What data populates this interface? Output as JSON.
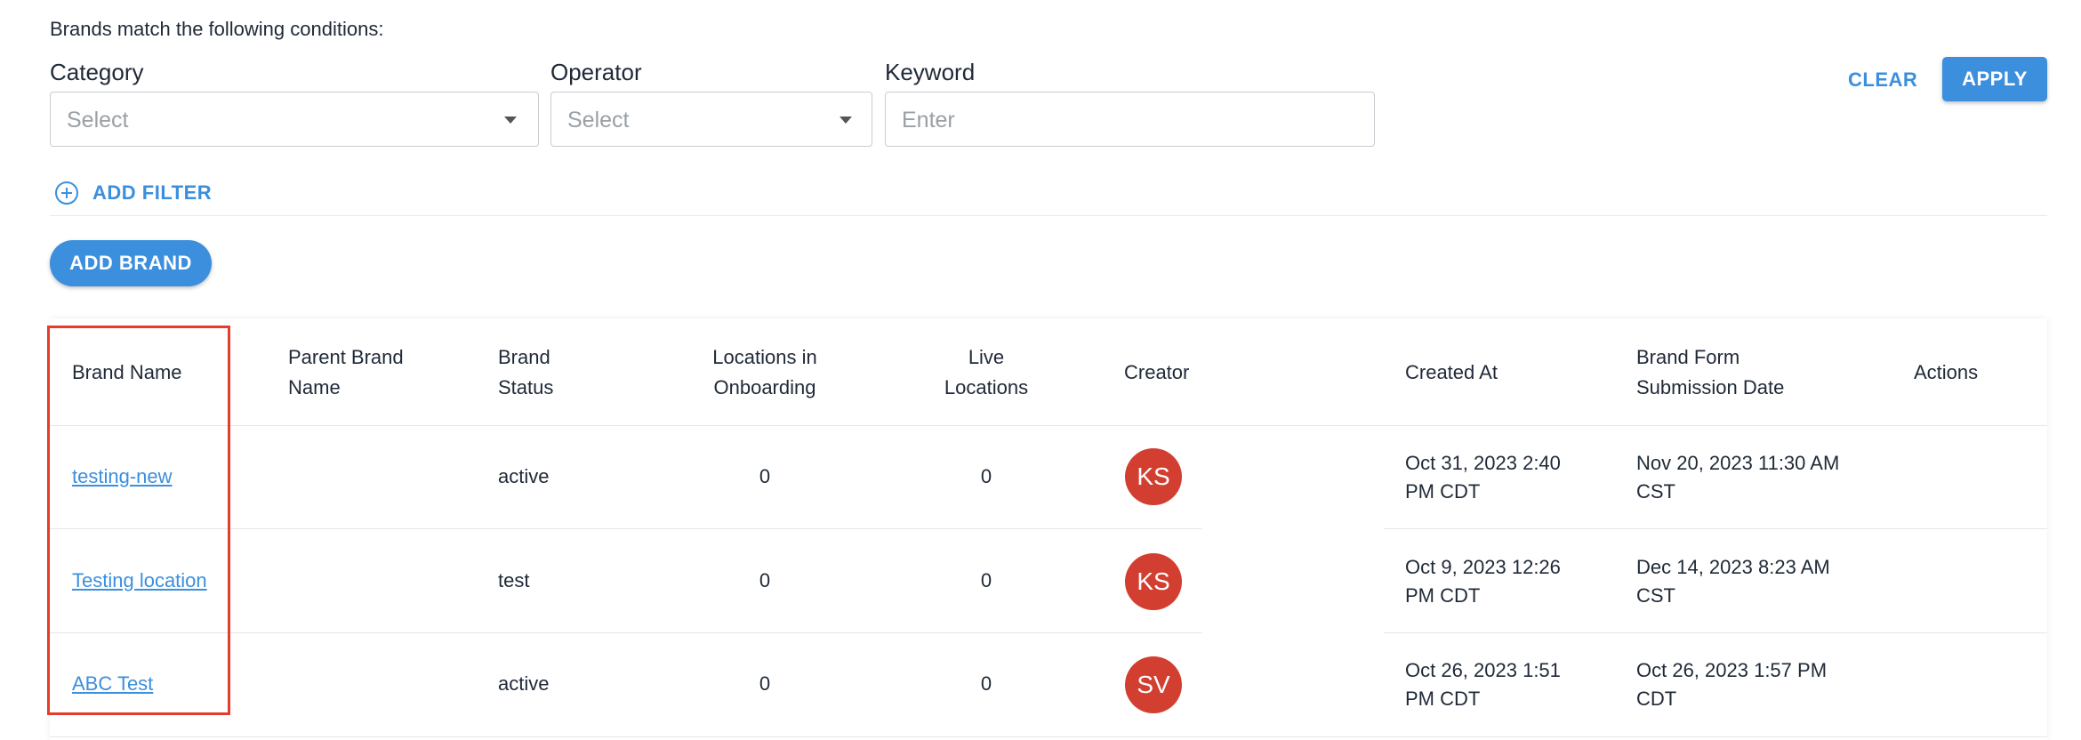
{
  "filters": {
    "conditions_text": "Brands match the following conditions:",
    "category": {
      "label": "Category",
      "placeholder": "Select"
    },
    "operator": {
      "label": "Operator",
      "placeholder": "Select"
    },
    "keyword": {
      "label": "Keyword",
      "placeholder": "Enter"
    },
    "clear_label": "CLEAR",
    "apply_label": "APPLY",
    "add_filter_label": "ADD FILTER"
  },
  "add_brand_label": "ADD BRAND",
  "table": {
    "headers": {
      "brand_name": "Brand Name",
      "parent_brand_name_1": "Parent Brand",
      "parent_brand_name_2": "Name",
      "brand_status_1": "Brand",
      "brand_status_2": "Status",
      "locations_onboarding_1": "Locations in",
      "locations_onboarding_2": "Onboarding",
      "live_locations_1": "Live",
      "live_locations_2": "Locations",
      "creator": "Creator",
      "created_at": "Created At",
      "submission_date_1": "Brand Form",
      "submission_date_2": "Submission Date",
      "actions": "Actions"
    },
    "rows": [
      {
        "brand_name": "testing-new",
        "parent_brand_name": "",
        "status": "active",
        "locations_onboarding": "0",
        "live_locations": "0",
        "creator_initials": "KS",
        "created_at_1": "Oct 31, 2023 2:40",
        "created_at_2": "PM CDT",
        "submission_1": "Nov 20, 2023 11:30 AM",
        "submission_2": "CST"
      },
      {
        "brand_name": "Testing location",
        "parent_brand_name": "",
        "status": "test",
        "locations_onboarding": "0",
        "live_locations": "0",
        "creator_initials": "KS",
        "created_at_1": "Oct 9, 2023 12:26",
        "created_at_2": "PM CDT",
        "submission_1": "Dec 14, 2023 8:23 AM",
        "submission_2": "CST"
      },
      {
        "brand_name": "ABC Test",
        "parent_brand_name": "",
        "status": "active",
        "locations_onboarding": "0",
        "live_locations": "0",
        "creator_initials": "SV",
        "created_at_1": "Oct 26, 2023 1:51",
        "created_at_2": "PM CDT",
        "submission_1": "Oct 26, 2023 1:57 PM",
        "submission_2": "CDT"
      }
    ]
  },
  "colors": {
    "accent": "#3b8fdd",
    "avatar": "#d23f31",
    "highlight": "#e53d2a"
  }
}
